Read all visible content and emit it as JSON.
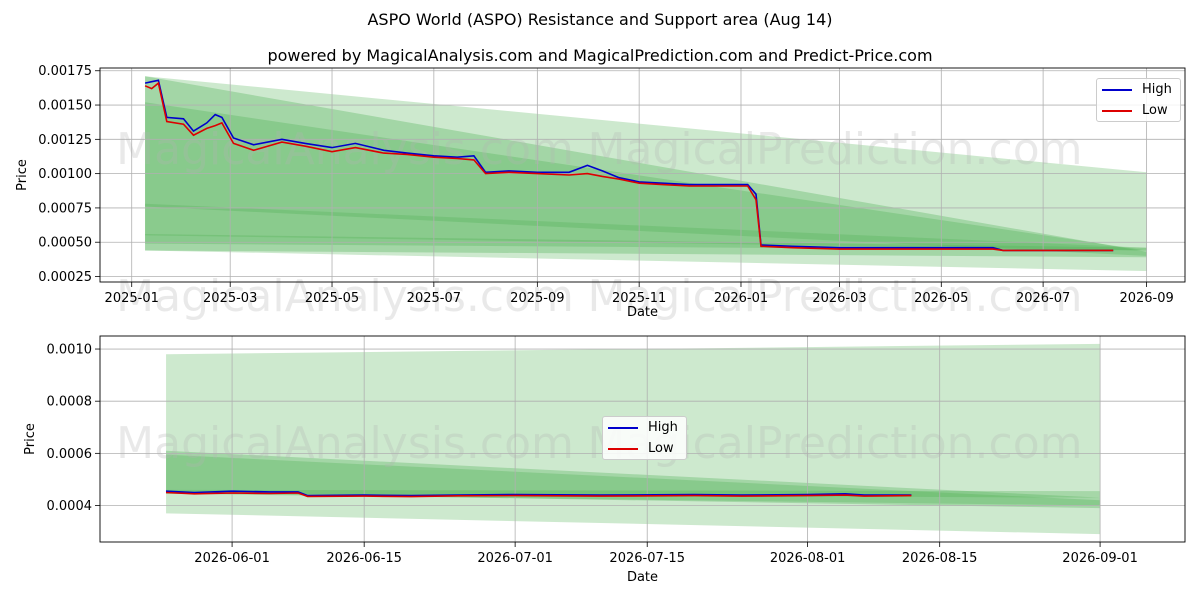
{
  "header": {
    "title": "ASPO World (ASPO) Resistance and Support area (Aug 14)",
    "subtitle": "powered by MagicalAnalysis.com and MagicalPrediction.com and Predict-Price.com"
  },
  "watermarks": [
    "MagicalAnalysis.com",
    "MagicalPrediction.com"
  ],
  "colors": {
    "high": "#0000cc",
    "low": "#dd0000",
    "band": "#4caf50",
    "grid": "#b0b0b0"
  },
  "chart_data": [
    {
      "type": "line",
      "xlabel": "Date",
      "ylabel": "Price",
      "xlim": [
        "2024-12-13",
        "2026-09-24"
      ],
      "ylim": [
        0.00021,
        0.00177
      ],
      "x_ticks": [
        "2025-01",
        "2025-03",
        "2025-05",
        "2025-07",
        "2025-09",
        "2025-11",
        "2026-01",
        "2026-03",
        "2026-05",
        "2026-07",
        "2026-09"
      ],
      "y_ticks": [
        0.00025,
        0.0005,
        0.00075,
        0.001,
        0.00125,
        0.0015,
        0.00175
      ],
      "y_tick_labels": [
        "0.00025",
        "0.00050",
        "0.00075",
        "0.00100",
        "0.00125",
        "0.00150",
        "0.00175"
      ],
      "legend": {
        "position": "top-right",
        "entries": [
          "High",
          "Low"
        ]
      },
      "grid": true,
      "series": [
        {
          "name": "High",
          "points": [
            [
              "2025-01-09",
              0.00166
            ],
            [
              "2025-01-13",
              0.00167
            ],
            [
              "2025-01-17",
              0.00168
            ],
            [
              "2025-01-22",
              0.00141
            ],
            [
              "2025-02-01",
              0.0014
            ],
            [
              "2025-02-07",
              0.00131
            ],
            [
              "2025-02-15",
              0.00137
            ],
            [
              "2025-02-20",
              0.00143
            ],
            [
              "2025-02-24",
              0.00141
            ],
            [
              "2025-03-03",
              0.00126
            ],
            [
              "2025-03-15",
              0.00121
            ],
            [
              "2025-04-01",
              0.00125
            ],
            [
              "2025-04-15",
              0.00122
            ],
            [
              "2025-05-01",
              0.00119
            ],
            [
              "2025-05-15",
              0.00122
            ],
            [
              "2025-06-01",
              0.00117
            ],
            [
              "2025-06-15",
              0.00115
            ],
            [
              "2025-07-01",
              0.00113
            ],
            [
              "2025-07-15",
              0.00112
            ],
            [
              "2025-07-25",
              0.00113
            ],
            [
              "2025-08-01",
              0.00101
            ],
            [
              "2025-08-15",
              0.00102
            ],
            [
              "2025-09-01",
              0.00101
            ],
            [
              "2025-09-20",
              0.00101
            ],
            [
              "2025-10-01",
              0.00106
            ],
            [
              "2025-10-10",
              0.00102
            ],
            [
              "2025-10-20",
              0.00097
            ],
            [
              "2025-11-01",
              0.00094
            ],
            [
              "2025-11-15",
              0.00093
            ],
            [
              "2025-12-01",
              0.00092
            ],
            [
              "2025-12-20",
              0.00092
            ],
            [
              "2026-01-05",
              0.00092
            ],
            [
              "2026-01-10",
              0.00085
            ],
            [
              "2026-01-13",
              0.00048
            ],
            [
              "2026-02-01",
              0.00047
            ],
            [
              "2026-03-01",
              0.00046
            ],
            [
              "2026-04-01",
              0.00046
            ],
            [
              "2026-05-01",
              0.00046
            ],
            [
              "2026-06-01",
              0.00046
            ],
            [
              "2026-06-07",
              0.00044
            ],
            [
              "2026-07-01",
              0.00044
            ],
            [
              "2026-08-12",
              0.00044
            ]
          ]
        },
        {
          "name": "Low",
          "points": [
            [
              "2025-01-09",
              0.00164
            ],
            [
              "2025-01-13",
              0.00162
            ],
            [
              "2025-01-17",
              0.00166
            ],
            [
              "2025-01-22",
              0.00138
            ],
            [
              "2025-02-01",
              0.00136
            ],
            [
              "2025-02-07",
              0.00128
            ],
            [
              "2025-02-15",
              0.00133
            ],
            [
              "2025-02-20",
              0.00135
            ],
            [
              "2025-02-24",
              0.00137
            ],
            [
              "2025-03-03",
              0.00122
            ],
            [
              "2025-03-15",
              0.00117
            ],
            [
              "2025-04-01",
              0.00123
            ],
            [
              "2025-04-15",
              0.0012
            ],
            [
              "2025-05-01",
              0.00116
            ],
            [
              "2025-05-15",
              0.00119
            ],
            [
              "2025-06-01",
              0.00115
            ],
            [
              "2025-06-15",
              0.00114
            ],
            [
              "2025-07-01",
              0.00112
            ],
            [
              "2025-07-15",
              0.00111
            ],
            [
              "2025-07-25",
              0.0011
            ],
            [
              "2025-08-01",
              0.001
            ],
            [
              "2025-08-15",
              0.00101
            ],
            [
              "2025-09-01",
              0.001
            ],
            [
              "2025-09-20",
              0.00099
            ],
            [
              "2025-10-01",
              0.001
            ],
            [
              "2025-10-10",
              0.00098
            ],
            [
              "2025-10-20",
              0.00096
            ],
            [
              "2025-11-01",
              0.00093
            ],
            [
              "2025-11-15",
              0.00092
            ],
            [
              "2025-12-01",
              0.00091
            ],
            [
              "2025-12-20",
              0.00091
            ],
            [
              "2026-01-05",
              0.00091
            ],
            [
              "2026-01-10",
              0.00081
            ],
            [
              "2026-01-13",
              0.00047
            ],
            [
              "2026-02-01",
              0.00046
            ],
            [
              "2026-03-01",
              0.00045
            ],
            [
              "2026-04-01",
              0.00045
            ],
            [
              "2026-05-01",
              0.00045
            ],
            [
              "2026-06-01",
              0.00045
            ],
            [
              "2026-06-07",
              0.00044
            ],
            [
              "2026-07-01",
              0.00044
            ],
            [
              "2026-08-12",
              0.00044
            ]
          ]
        }
      ],
      "bands": [
        {
          "opacity": 0.28,
          "start": "2025-01-09",
          "end": "2026-09-01",
          "top": [
            0.00171,
            0.00101
          ],
          "bottom": [
            0.00044,
            0.00029
          ]
        },
        {
          "opacity": 0.32,
          "start": "2025-01-09",
          "end": "2026-09-01",
          "top": [
            0.00171,
            0.00043
          ],
          "bottom": [
            0.00044,
            0.00039
          ]
        },
        {
          "opacity": 0.3,
          "start": "2025-01-09",
          "end": "2026-09-01",
          "top": [
            0.00152,
            0.00044
          ],
          "bottom": [
            0.00076,
            0.0004
          ]
        },
        {
          "opacity": 0.28,
          "start": "2025-01-09",
          "end": "2026-09-01",
          "top": [
            0.00078,
            0.00046
          ],
          "bottom": [
            0.00055,
            0.00044
          ]
        },
        {
          "opacity": 0.3,
          "start": "2025-01-09",
          "end": "2026-09-01",
          "top": [
            0.00056,
            0.00046
          ],
          "bottom": [
            0.00049,
            0.00044
          ]
        }
      ]
    },
    {
      "type": "line",
      "xlabel": "Date",
      "ylabel": "Price",
      "xlim": [
        "2026-05-18",
        "2026-09-10"
      ],
      "ylim": [
        0.00026,
        0.00105
      ],
      "x_ticks": [
        "2026-06-01",
        "2026-06-15",
        "2026-07-01",
        "2026-07-15",
        "2026-08-01",
        "2026-08-15",
        "2026-09-01"
      ],
      "y_ticks": [
        0.0004,
        0.0006,
        0.0008,
        0.001
      ],
      "y_tick_labels": [
        "0.0004",
        "0.0006",
        "0.0008",
        "0.0010"
      ],
      "legend": {
        "position": "center",
        "entries": [
          "High",
          "Low"
        ]
      },
      "grid": true,
      "series": [
        {
          "name": "High",
          "points": [
            [
              "2026-05-25",
              0.000455
            ],
            [
              "2026-05-28",
              0.00045
            ],
            [
              "2026-06-01",
              0.000455
            ],
            [
              "2026-06-05",
              0.000452
            ],
            [
              "2026-06-08",
              0.000452
            ],
            [
              "2026-06-09",
              0.000438
            ],
            [
              "2026-06-15",
              0.00044
            ],
            [
              "2026-06-20",
              0.000438
            ],
            [
              "2026-06-25",
              0.00044
            ],
            [
              "2026-07-01",
              0.000442
            ],
            [
              "2026-07-10",
              0.00044
            ],
            [
              "2026-07-20",
              0.000442
            ],
            [
              "2026-07-25",
              0.00044
            ],
            [
              "2026-08-01",
              0.000442
            ],
            [
              "2026-08-05",
              0.000445
            ],
            [
              "2026-08-07",
              0.00044
            ],
            [
              "2026-08-12",
              0.00044
            ]
          ]
        },
        {
          "name": "Low",
          "points": [
            [
              "2026-05-25",
              0.00045
            ],
            [
              "2026-05-28",
              0.000445
            ],
            [
              "2026-06-01",
              0.000448
            ],
            [
              "2026-06-05",
              0.000446
            ],
            [
              "2026-06-08",
              0.000448
            ],
            [
              "2026-06-09",
              0.000435
            ],
            [
              "2026-06-15",
              0.000436
            ],
            [
              "2026-06-20",
              0.000434
            ],
            [
              "2026-06-25",
              0.000437
            ],
            [
              "2026-07-01",
              0.000438
            ],
            [
              "2026-07-10",
              0.000436
            ],
            [
              "2026-07-20",
              0.000438
            ],
            [
              "2026-07-25",
              0.000436
            ],
            [
              "2026-08-01",
              0.000438
            ],
            [
              "2026-08-05",
              0.00044
            ],
            [
              "2026-08-07",
              0.000436
            ],
            [
              "2026-08-12",
              0.000438
            ]
          ]
        }
      ],
      "bands": [
        {
          "opacity": 0.28,
          "start": "2026-05-25",
          "end": "2026-09-01",
          "top": [
            0.00098,
            0.00102
          ],
          "bottom": [
            0.00037,
            0.00029
          ]
        },
        {
          "opacity": 0.32,
          "start": "2026-05-25",
          "end": "2026-09-01",
          "top": [
            0.00061,
            0.00043
          ],
          "bottom": [
            0.00045,
            0.00039
          ]
        },
        {
          "opacity": 0.3,
          "start": "2026-05-25",
          "end": "2026-09-01",
          "top": [
            0.000595,
            0.00042
          ],
          "bottom": [
            0.000445,
            0.0004
          ]
        },
        {
          "opacity": 0.3,
          "start": "2026-05-25",
          "end": "2026-09-01",
          "top": [
            0.00046,
            0.000455
          ],
          "bottom": [
            0.000445,
            0.00043
          ]
        }
      ]
    }
  ]
}
